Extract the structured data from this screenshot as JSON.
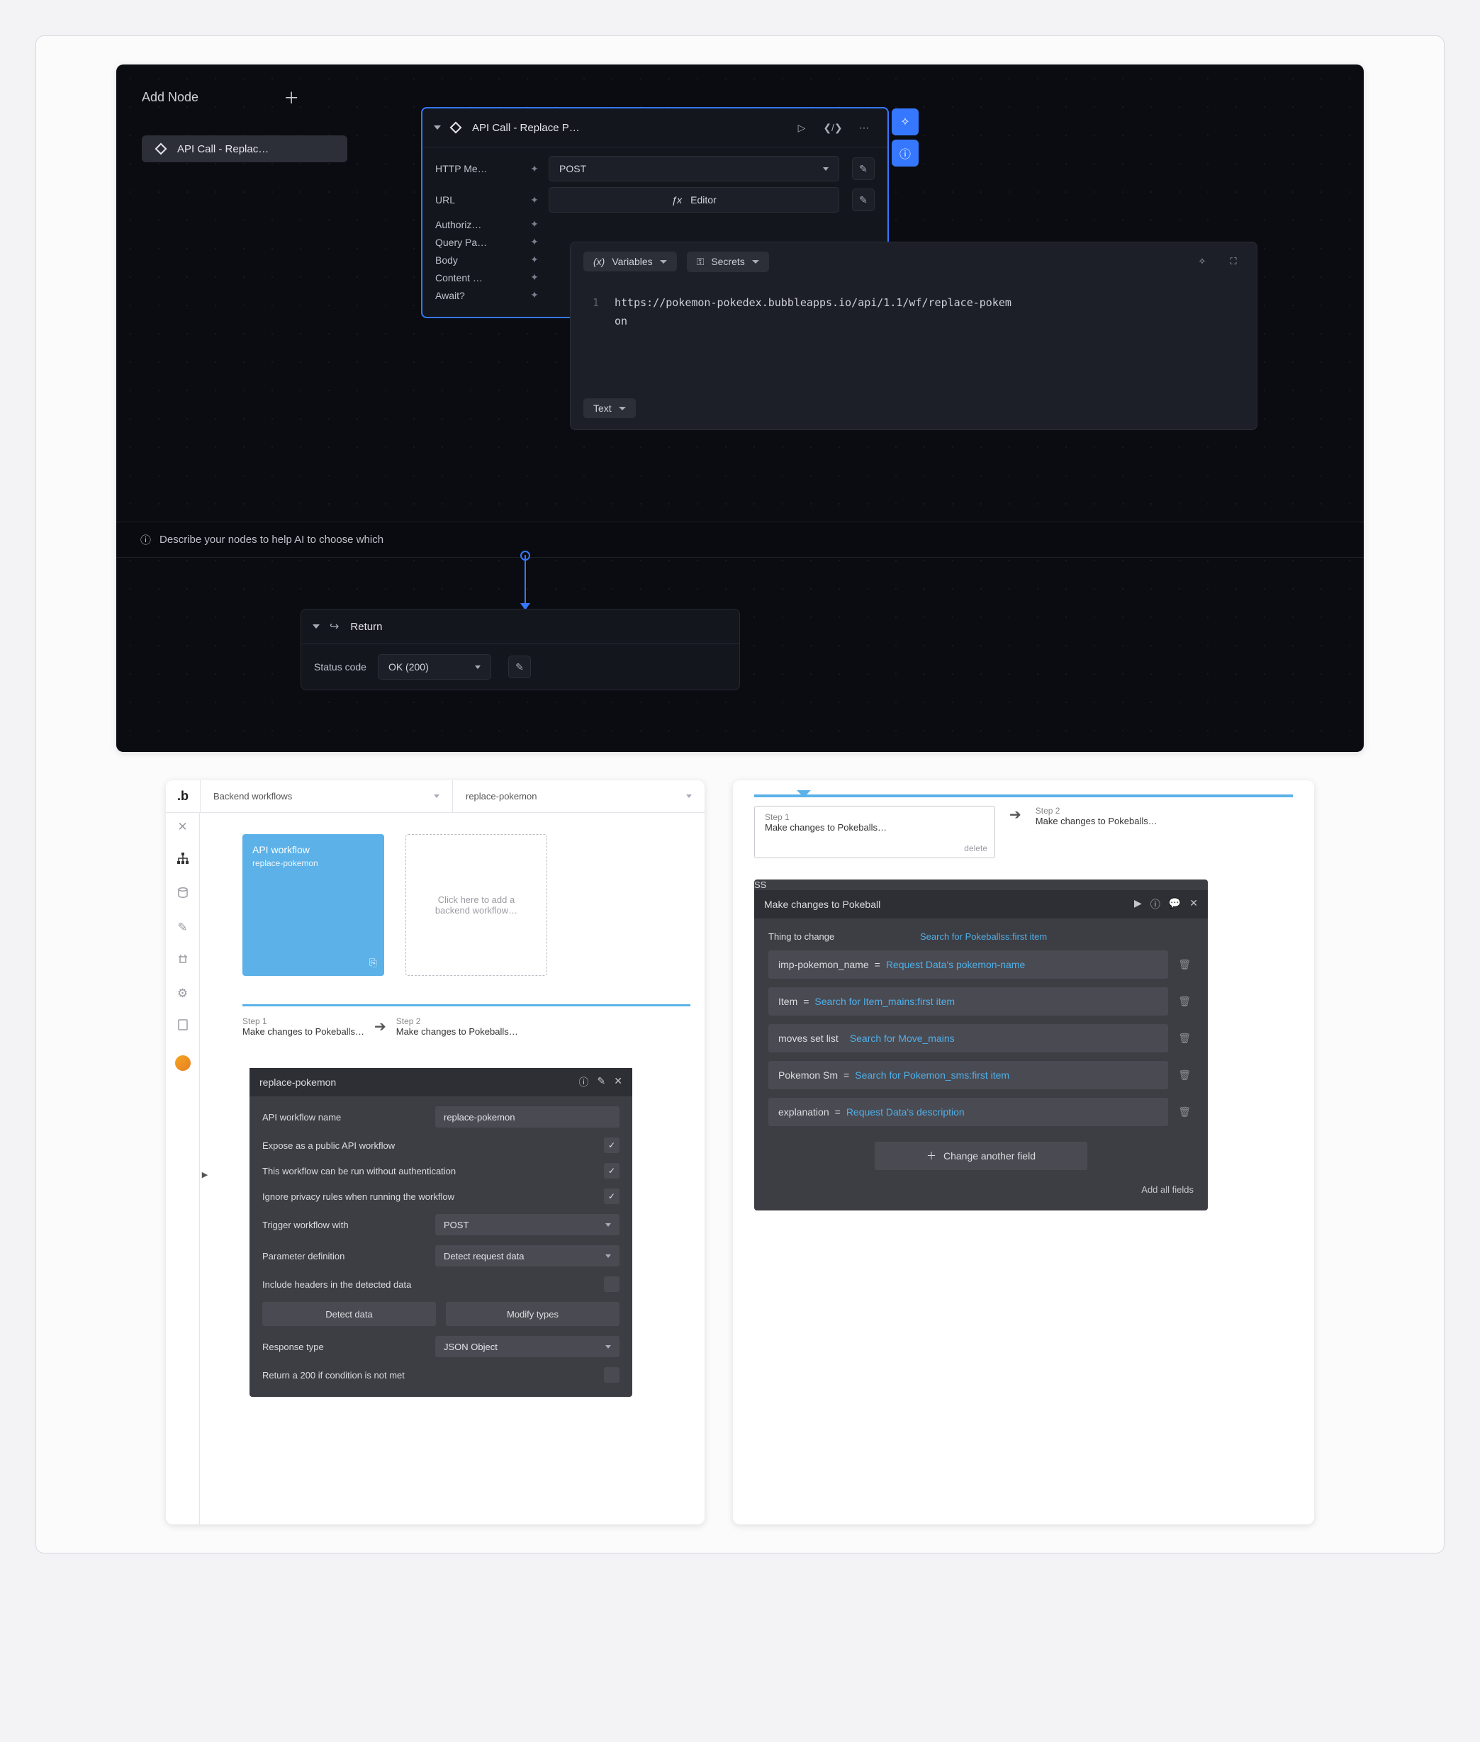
{
  "top": {
    "addNode": "Add Node",
    "pill": "API Call - Replac…",
    "nodeTitle": "API Call - Replace P…",
    "fields": {
      "httpMethod": {
        "label": "HTTP Me…",
        "value": "POST"
      },
      "url": {
        "label": "URL",
        "value": "Editor"
      },
      "auth": {
        "label": "Authoriz…"
      },
      "query": {
        "label": "Query Pa…"
      },
      "body": {
        "label": "Body"
      },
      "contentType": {
        "label": "Content …"
      },
      "await": {
        "label": "Await?"
      }
    },
    "hint": "Describe your nodes to help AI to choose which",
    "returnLabel": "Return",
    "statusCode": {
      "label": "Status code",
      "value": "OK (200)"
    },
    "codePanel": {
      "variables": "Variables",
      "secrets": "Secrets",
      "code": "https://pokemon-pokedex.bubbleapps.io/api/1.1/wf/replace-pokemon",
      "mode": "Text"
    }
  },
  "bubbleLeft": {
    "topSelectA": "Backend workflows",
    "topSelectB": "replace-pokemon",
    "tile": {
      "title": "API workflow",
      "subtitle": "replace-pokemon"
    },
    "addTile": "Click here to add a backend workflow…",
    "steps": [
      {
        "label": "Step 1",
        "title": "Make changes to Pokeballs…"
      },
      {
        "label": "Step 2",
        "title": "Make changes to Pokeballs…"
      }
    ],
    "panel": {
      "title": "replace-pokemon",
      "rows": {
        "name": {
          "label": "API workflow name",
          "value": "replace-pokemon"
        },
        "expose": "Expose as a public API workflow",
        "noauth": "This workflow can be run without authentication",
        "ignore": "Ignore privacy rules when running the workflow",
        "trigger": {
          "label": "Trigger workflow with",
          "value": "POST"
        },
        "paramDef": {
          "label": "Parameter definition",
          "value": "Detect request data"
        },
        "includeHeaders": "Include headers in the detected data",
        "detectBtn": "Detect data",
        "modifyBtn": "Modify types",
        "response": {
          "label": "Response type",
          "value": "JSON Object"
        },
        "return200": "Return a 200 if condition is not met"
      }
    }
  },
  "bubbleRight": {
    "steps": [
      {
        "label": "Step 1",
        "title": "Make changes to Pokeballs…",
        "delete": "delete"
      },
      {
        "label": "Step 2",
        "title": "Make changes to Pokeballs…"
      }
    ],
    "panel": {
      "title": "Make changes to Pokeball",
      "thingLabel": "Thing to change",
      "thingValue": "Search for Pokeballss:first item",
      "fields": [
        {
          "name": "imp-pokemon_name",
          "op": "=",
          "value": "Request Data's pokemon-name"
        },
        {
          "name": "Item",
          "op": "=",
          "value": "Search for Item_mains:first item"
        },
        {
          "name": "moves set list",
          "op": "",
          "value": "Search for Move_mains"
        },
        {
          "name": "Pokemon Sm",
          "op": "=",
          "value": "Search for Pokemon_sms:first item"
        },
        {
          "name": "explanation",
          "op": "=",
          "value": "Request Data's description"
        }
      ],
      "changeBtn": "Change another field",
      "addAll": "Add all fields"
    }
  }
}
